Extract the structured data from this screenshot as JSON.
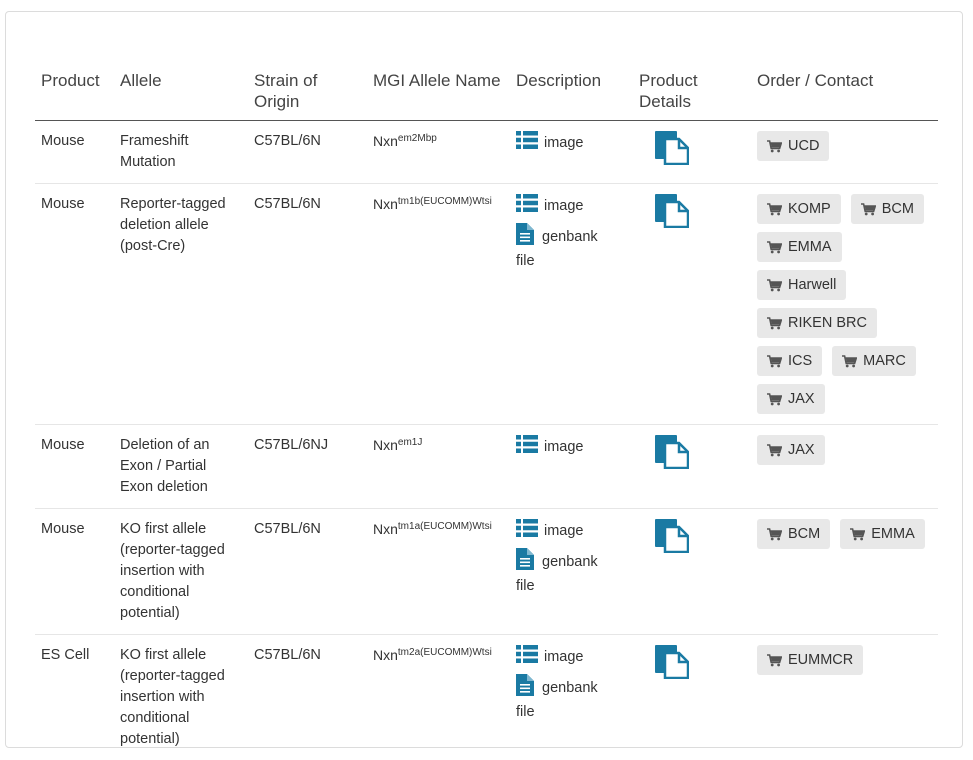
{
  "headers": [
    "Product",
    "Allele",
    "Strain of Origin",
    "MGI Allele Name",
    "Description",
    "Product Details",
    "Order / Contact"
  ],
  "link_labels": {
    "image": "image",
    "genbank": "genbank",
    "file": "file"
  },
  "colors": {
    "accent": "#1a7aa3",
    "button_bg": "#e8e8e8"
  },
  "rows": [
    {
      "product": "Mouse",
      "allele": "Frameshift Mutation",
      "strain": "C57BL/6N",
      "mgi_base": "Nxn",
      "mgi_sup": "em2Mbp",
      "genbank": false,
      "order": [
        "UCD"
      ]
    },
    {
      "product": "Mouse",
      "allele": "Reporter-tagged deletion allele (post-Cre)",
      "strain": "C57BL/6N",
      "mgi_base": "Nxn",
      "mgi_sup": "tm1b(EUCOMM)Wtsi",
      "genbank": true,
      "order": [
        "KOMP",
        "BCM",
        "EMMA",
        "Harwell",
        "RIKEN BRC",
        "ICS",
        "MARC",
        "JAX"
      ]
    },
    {
      "product": "Mouse",
      "allele": "Deletion of an Exon / Partial Exon deletion",
      "strain": "C57BL/6NJ",
      "mgi_base": "Nxn",
      "mgi_sup": "em1J",
      "genbank": false,
      "order": [
        "JAX"
      ]
    },
    {
      "product": "Mouse",
      "allele": "KO first allele (reporter-tagged insertion with conditional potential)",
      "strain": "C57BL/6N",
      "mgi_base": "Nxn",
      "mgi_sup": "tm1a(EUCOMM)Wtsi",
      "genbank": true,
      "order": [
        "BCM",
        "EMMA"
      ]
    },
    {
      "product": "ES Cell",
      "allele": "KO first allele (reporter-tagged insertion with conditional potential)",
      "strain": "C57BL/6N",
      "mgi_base": "Nxn",
      "mgi_sup": "tm2a(EUCOMM)Wtsi",
      "genbank": true,
      "order": [
        "EUMMCR"
      ]
    }
  ]
}
